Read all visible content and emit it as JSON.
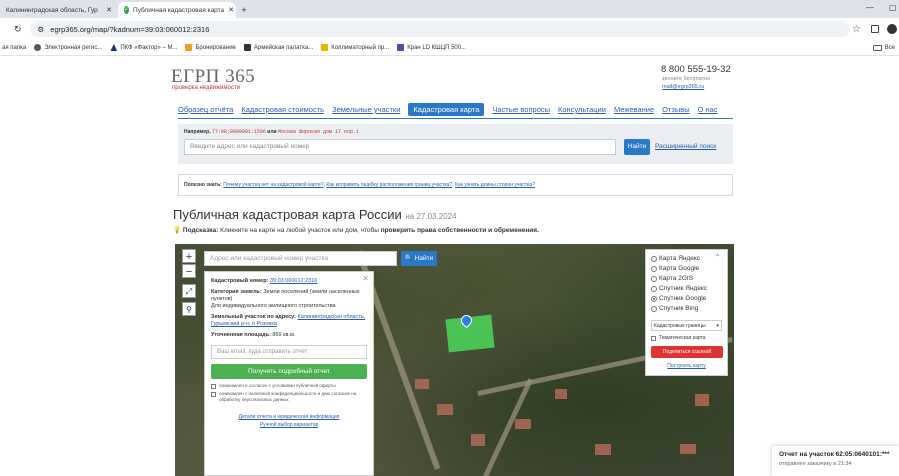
{
  "browser": {
    "tabs": [
      {
        "label": "Калининградская область, Гур",
        "active": false
      },
      {
        "label": "Публичная кадастровая карта",
        "active": true
      }
    ],
    "url": "egrp365.org/map/?kadnum=39:03:060012:2316",
    "bookmarks": [
      {
        "label": "Электронная регис...",
        "color": "#555555"
      },
      {
        "label": "ПКФ «Фактор» – М...",
        "color": "#1a3a80"
      },
      {
        "label": "Бронирование",
        "color": "#f0a020"
      },
      {
        "label": "Армейская палатка...",
        "color": "#333333"
      },
      {
        "label": "Коллиматорный пр...",
        "color": "#e8b400"
      },
      {
        "label": "Кран LD КШЦП 500...",
        "color": "#5050a0"
      }
    ],
    "bookmark_first_fragment": "ая папка",
    "bookmarks_all": "Все"
  },
  "site": {
    "logo": "ЕГРП 365",
    "logo_sub": "проверка недвижимости",
    "phone": "8 800 555-19-32",
    "phone_sub": "звоните бесплатно",
    "email": "mail@egrp365.ru"
  },
  "menu": [
    {
      "label": "Образец отчёта",
      "active": false
    },
    {
      "label": "Кадастровая стоимость",
      "active": false
    },
    {
      "label": "Земельные участки",
      "active": false
    },
    {
      "label": "Кадастровая карта",
      "active": true
    },
    {
      "label": "Частые вопросы",
      "active": false
    },
    {
      "label": "Консультации",
      "active": false
    },
    {
      "label": "Межевание",
      "active": false
    },
    {
      "label": "Отзывы",
      "active": false
    },
    {
      "label": "О нас",
      "active": false
    }
  ],
  "search": {
    "example_label": "Например,",
    "example_code": "77:08:0009001:1596",
    "example_or": "или",
    "example_address": "Москва Широкая дом 17 кор.1",
    "placeholder": "Введите адрес или кадастровый номер",
    "button": "Найти",
    "advanced": "Расширенный поиск"
  },
  "useful": {
    "label": "Полезно знать:",
    "links": [
      "Почему участка нет на кадастровой карте?",
      "Как исправить ошибку расположения границ участка?",
      "Как узнать длины сторон участка?"
    ]
  },
  "page": {
    "title": "Публичная кадастровая карта России",
    "date": "на 27.03.2024",
    "hint_label": "Подсказка:",
    "hint_text": "Кликните на карте на любой участок или дом, чтобы",
    "hint_bold": "проверить права собственности и обременения."
  },
  "map": {
    "search_placeholder": "Адрес или кадастровый номер участка",
    "search_button": "Найти",
    "zoom_in": "+",
    "zoom_out": "−",
    "card": {
      "kad_label": "Кадастровый номер:",
      "kad_value": "39:03:060012:2316",
      "category_label": "Категория земель:",
      "category_value": "Земли поселений (земли населенных пунктов)",
      "purpose": "Для индивидуального жилищного строительства",
      "address_label": "Земельный участок по адресу:",
      "address_value": "Калининградская область, Гурьевский р-н, п Розовка",
      "area_label": "Уточненная площадь:",
      "area_value": "869 кв.м.",
      "email_placeholder": "Ваш email, куда отправить отчет",
      "report_button": "Получить подробный отчет",
      "check1": "ознакомлен и согласен с условиями публичной оферты",
      "check2": "ознакомлен с политикой конфиденциальности и даю согласие на обработку персональных данных",
      "link1": "Детали отчета и юридическая информация",
      "link2": "Ручной выбор вариантов"
    },
    "layers": {
      "options": [
        {
          "label": "Карта Яндекс",
          "selected": false
        },
        {
          "label": "Карта Google",
          "selected": false
        },
        {
          "label": "Карта 2GIS",
          "selected": false
        },
        {
          "label": "Спутник Яндекс",
          "selected": false
        },
        {
          "label": "Спутник Google",
          "selected": true
        },
        {
          "label": "Спутник Bing",
          "selected": false
        }
      ],
      "select_value": "Кадастровые границы",
      "thematic": "Тематическая карта",
      "share_button": "Поделиться ссылкой",
      "build_link": "Построить карту"
    },
    "plot_color": "#4bd85a"
  },
  "toast": {
    "title": "Отчет на участок 62:05:0640101:***",
    "subtitle": "отправлен заказчику в 21:34"
  }
}
